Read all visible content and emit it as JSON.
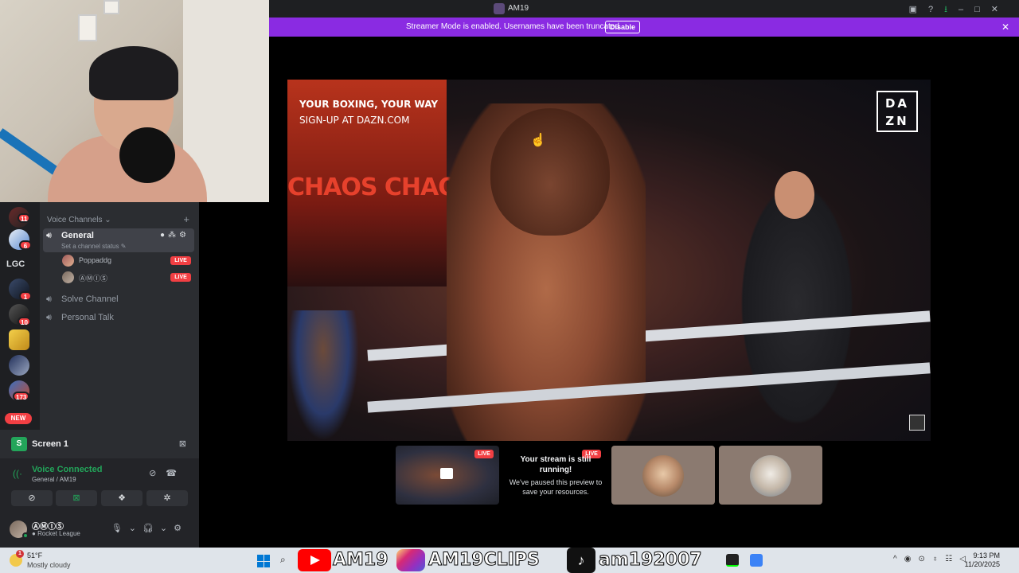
{
  "titlebar": {
    "title": "AM19"
  },
  "banner": {
    "text": "Streamer Mode is enabled. Usernames have been truncated.",
    "button": "Disable"
  },
  "rail": {
    "badges": [
      "11",
      "6",
      "1",
      "10",
      "173"
    ],
    "lgc_label": "LGC",
    "new_label": "NEW"
  },
  "sidebar": {
    "category": "Voice Channels",
    "channels": [
      {
        "name": "General",
        "status": "Set a channel status"
      },
      {
        "name": "Solve Channel"
      },
      {
        "name": "Personal Talk"
      }
    ],
    "members": [
      {
        "name": "Poppaddg",
        "live": "LIVE"
      },
      {
        "name": "ⒶⓂⒾⓈ",
        "live": "LIVE"
      }
    ]
  },
  "panel": {
    "screen_label": "Screen 1",
    "voice_connected": "Voice Connected",
    "voice_channel": "General / AM19",
    "user_name": "ⒶⓂⒾⓈ",
    "activity": "Rocket League"
  },
  "stream": {
    "promo_line1": "YOUR BOXING, YOUR WAY",
    "promo_line2": "SIGN-UP AT DAZN.COM",
    "logo": "DAZN",
    "backdrop_text": "CHAOS CHAOS"
  },
  "previews": {
    "live_label": "LIVE",
    "paused_title": "Your stream is still running!",
    "paused_sub": "We've paused this preview to save your resources."
  },
  "taskbar": {
    "badge": "1",
    "temp": "51°F",
    "condition": "Mostly cloudy",
    "brand_youtube": "AM19",
    "brand_instagram": "AM19CLIPS",
    "brand_tiktok": "am192007",
    "time": "9:13 PM",
    "date": "11/20/2025"
  },
  "colors": {
    "discord_bg": "#2b2d31",
    "rail_bg": "#1e1f22",
    "accent_green": "#23a55a",
    "live_red": "#f23f43",
    "banner_purple": "#8a2be2"
  }
}
